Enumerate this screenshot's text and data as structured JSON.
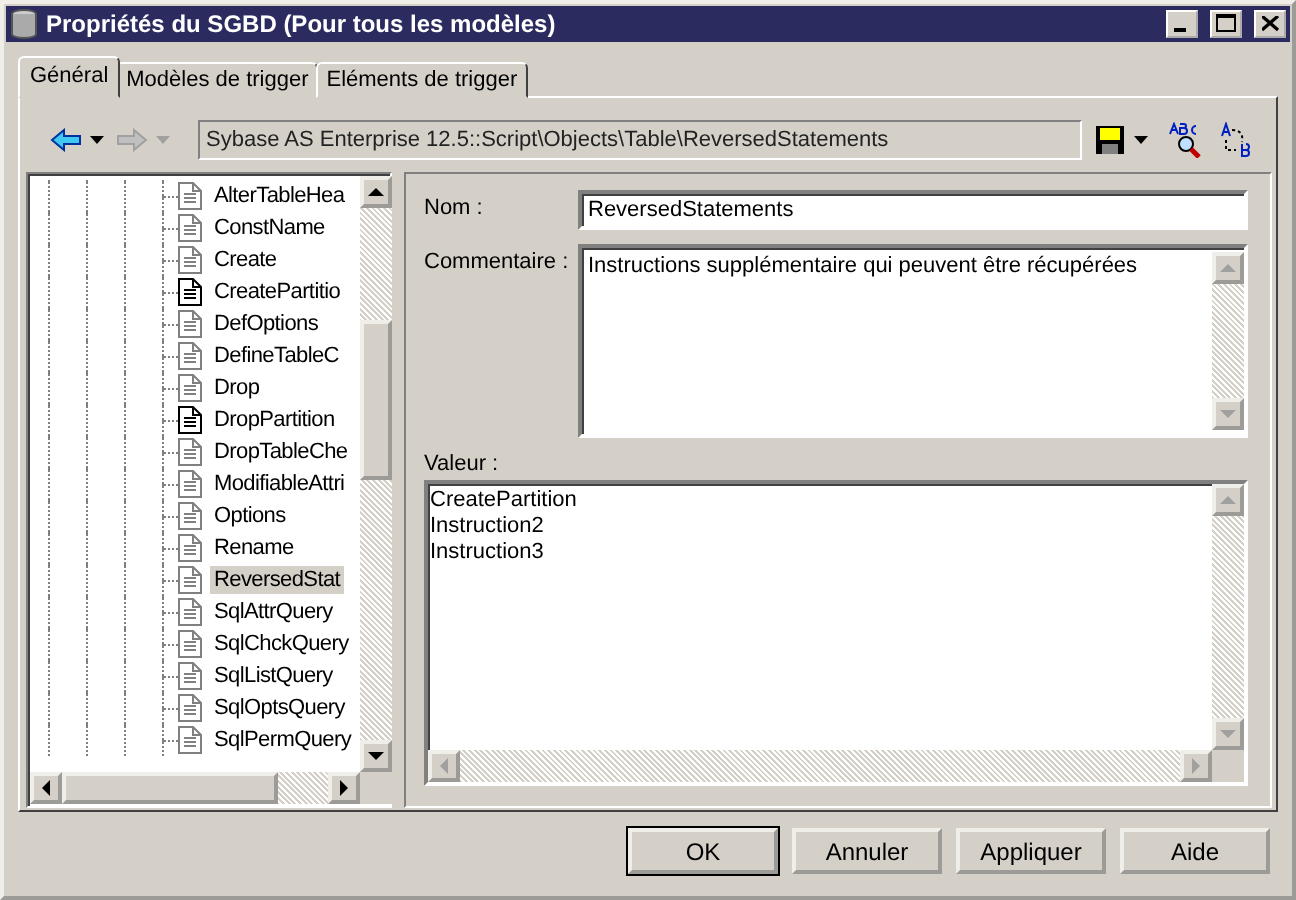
{
  "window": {
    "title": "Propriétés du SGBD (Pour tous les modèles)"
  },
  "tabs": [
    {
      "label": "Général",
      "selected": true
    },
    {
      "label": "Modèles de trigger",
      "selected": false
    },
    {
      "label": "Eléments de trigger",
      "selected": false
    }
  ],
  "toolbar": {
    "back_disabled": false,
    "forward_disabled": true,
    "path": "Sybase AS Enterprise 12.5::Script\\Objects\\Table\\ReversedStatements"
  },
  "tree": {
    "items": [
      {
        "label": "AlterTableHea",
        "dark_icon": false,
        "selected": false
      },
      {
        "label": "ConstName",
        "dark_icon": false,
        "selected": false
      },
      {
        "label": "Create",
        "dark_icon": false,
        "selected": false
      },
      {
        "label": "CreatePartitio",
        "dark_icon": true,
        "selected": false
      },
      {
        "label": "DefOptions",
        "dark_icon": false,
        "selected": false
      },
      {
        "label": "DefineTableC",
        "dark_icon": false,
        "selected": false
      },
      {
        "label": "Drop",
        "dark_icon": false,
        "selected": false
      },
      {
        "label": "DropPartition",
        "dark_icon": true,
        "selected": false
      },
      {
        "label": "DropTableChe",
        "dark_icon": false,
        "selected": false
      },
      {
        "label": "ModifiableAttri",
        "dark_icon": false,
        "selected": false
      },
      {
        "label": "Options",
        "dark_icon": false,
        "selected": false
      },
      {
        "label": "Rename",
        "dark_icon": false,
        "selected": false
      },
      {
        "label": "ReversedStat",
        "dark_icon": false,
        "selected": true
      },
      {
        "label": "SqlAttrQuery",
        "dark_icon": false,
        "selected": false
      },
      {
        "label": "SqlChckQuery",
        "dark_icon": false,
        "selected": false
      },
      {
        "label": "SqlListQuery",
        "dark_icon": false,
        "selected": false
      },
      {
        "label": "SqlOptsQuery",
        "dark_icon": false,
        "selected": false
      },
      {
        "label": "SqlPermQuery",
        "dark_icon": false,
        "selected": false
      }
    ]
  },
  "form": {
    "name_label": "Nom :",
    "name_value": "ReversedStatements",
    "comment_label": "Commentaire :",
    "comment_value": "Instructions supplémentaire qui peuvent être récupérées",
    "value_label": "Valeur :",
    "value_lines": [
      "CreatePartition",
      "Instruction2",
      "Instruction3"
    ]
  },
  "buttons": [
    {
      "label": "OK",
      "default": true
    },
    {
      "label": "Annuler",
      "default": false
    },
    {
      "label": "Appliquer",
      "default": false
    },
    {
      "label": "Aide",
      "default": false
    }
  ]
}
